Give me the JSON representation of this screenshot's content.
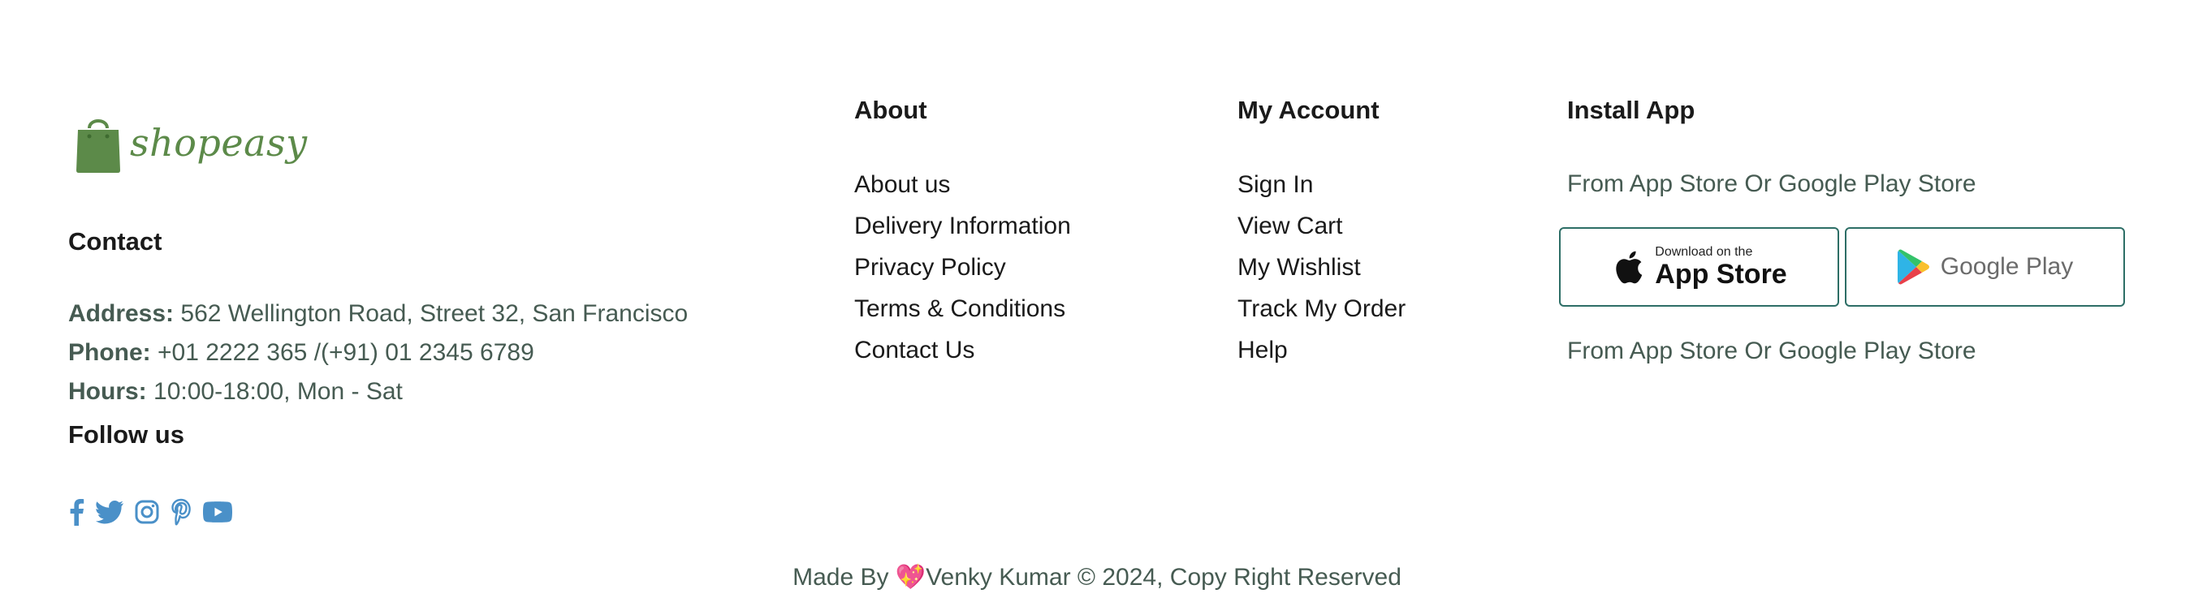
{
  "brand": {
    "name": "shopeasy",
    "icon": "shopping-bag-icon",
    "color": "#5c8a49"
  },
  "contact": {
    "heading": "Contact",
    "address_label": "Address:",
    "address_value": " 562 Wellington Road, Street 32, San Francisco",
    "phone_label": "Phone:",
    "phone_value": " +01 2222 365 /(+91) 01 2345 6789",
    "hours_label": "Hours:",
    "hours_value": " 10:00-18:00, Mon - Sat"
  },
  "follow": {
    "heading": "Follow us",
    "icons": [
      "facebook-icon",
      "twitter-icon",
      "instagram-icon",
      "pinterest-icon",
      "youtube-icon"
    ],
    "color": "#4a90c8"
  },
  "about": {
    "heading": "About",
    "links": [
      "About us",
      "Delivery Information",
      "Privacy Policy",
      "Terms & Conditions",
      "Contact Us"
    ]
  },
  "account": {
    "heading": "My Account",
    "links": [
      "Sign In",
      "View Cart",
      "My Wishlist",
      "Track My Order",
      "Help"
    ]
  },
  "install": {
    "heading": "Install App",
    "subtitle_top": "From App Store Or Google Play Store",
    "app_store_small": "Download on the",
    "app_store_big": "App Store",
    "google_play": "Google Play",
    "subtitle_bottom": "From App Store Or Google Play Store",
    "border_color": "#2d6e66"
  },
  "credit": {
    "prefix": "Made By ",
    "heart": "💖",
    "suffix": "Venky Kumar © 2024, Copy Right Reserved"
  }
}
